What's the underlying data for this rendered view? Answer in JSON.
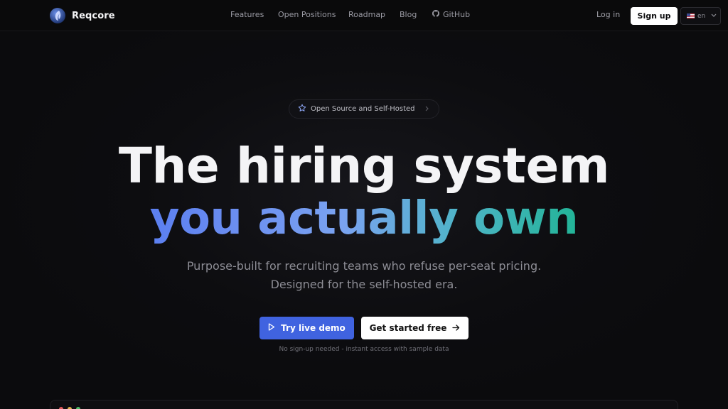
{
  "brand": {
    "name": "Reqcore"
  },
  "nav": {
    "links": [
      {
        "label": "Features"
      },
      {
        "label": "Open Positions"
      },
      {
        "label": "Roadmap"
      },
      {
        "label": "Blog"
      },
      {
        "label": "GitHub"
      }
    ],
    "login": "Log in",
    "signup": "Sign up",
    "language": "en"
  },
  "badge": {
    "label": "Open Source and Self-Hosted"
  },
  "hero": {
    "line1": "The hiring system",
    "line2": "you actually own",
    "sub1": "Purpose-built for recruiting teams who refuse per-seat pricing.",
    "sub2": "Designed for the self-hosted era."
  },
  "cta": {
    "demo": "Try live demo",
    "start": "Get started free",
    "note": "No sign-up needed - instant access with sample data"
  },
  "colors": {
    "accent": "#4063e0",
    "gradient_start": "#5b7ff0",
    "gradient_end": "#22b497",
    "background": "#0b0b0d"
  }
}
